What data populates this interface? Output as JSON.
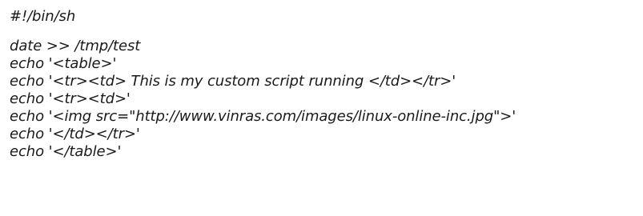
{
  "script": {
    "shebang": "#!/bin/sh",
    "lines": [
      "date >> /tmp/test",
      "echo '<table>'",
      "echo '<tr><td> This is my custom script running </td></tr>'",
      "echo '<tr><td>'",
      "echo '<img src=\"http://www.vinras.com/images/linux-online-inc.jpg\">'",
      "echo '</td></tr>'",
      "echo '</table>'"
    ]
  }
}
